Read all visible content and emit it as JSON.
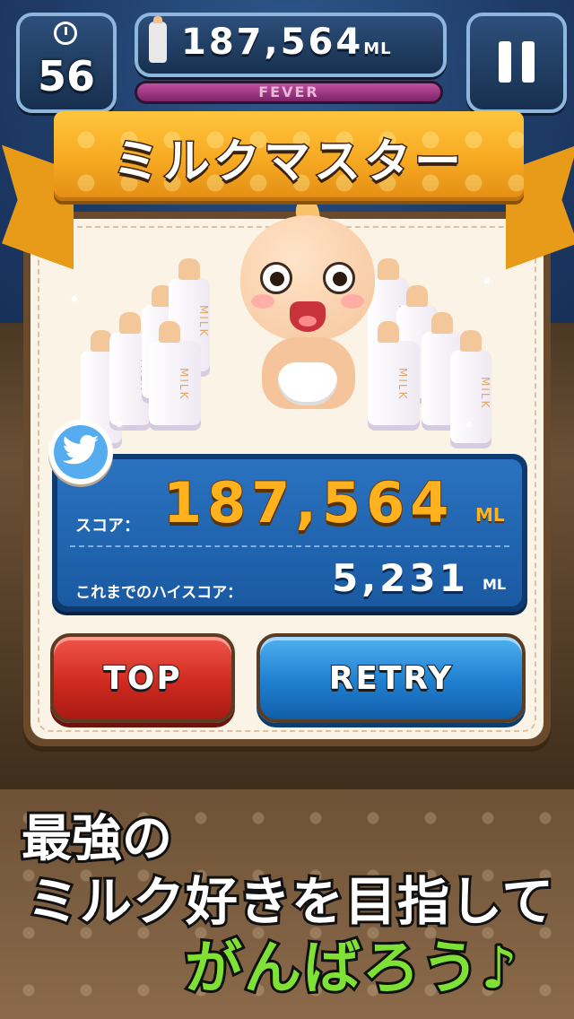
{
  "hud": {
    "timer_value": "56",
    "score_value": "187,564",
    "score_unit": "ML",
    "fever_label": "FEVER"
  },
  "result": {
    "title": "ミルクマスター",
    "bottle_label": "MILK",
    "score_label": "スコア：",
    "score_value": "187,564",
    "score_unit": "ML",
    "high_score_label": "これまでのハイスコア：",
    "high_score_value": "5,231",
    "high_score_unit": "ML"
  },
  "buttons": {
    "top_label": "TOP",
    "retry_label": "RETRY"
  },
  "caption": {
    "line1": "最強の",
    "line2": "ミルク好きを目指して",
    "line3": "がんばろう♪"
  },
  "colors": {
    "accent_orange": "#f7a922",
    "score_gold": "#ffb21e",
    "retry_blue": "#1f7fd0",
    "top_red": "#d02a20",
    "caption_green": "#7fe036",
    "twitter_blue": "#55acee"
  },
  "icons": {
    "timer": "clock-icon",
    "score": "milk-bottle-icon",
    "pause": "pause-icon",
    "share": "twitter-bird-icon"
  }
}
